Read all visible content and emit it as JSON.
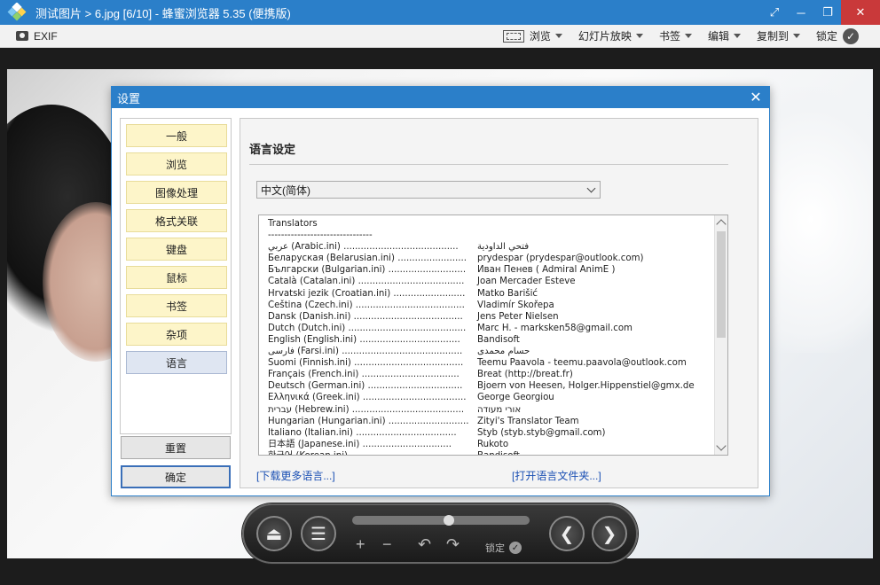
{
  "window": {
    "title": "测试图片 > 6.jpg [6/10] - 蜂蜜浏览器 5.35 (便携版)",
    "controls": [
      "⤢",
      "─",
      "❐",
      "✕"
    ]
  },
  "toolbar": {
    "exif": "EXIF",
    "menus": [
      "浏览",
      "幻灯片放映",
      "书签",
      "编辑",
      "复制到"
    ],
    "lock": "锁定",
    "lock_check": "✓"
  },
  "player": {
    "eject": "⏏",
    "menu": "☰",
    "plus": "+",
    "minus": "−",
    "rot_left": "↶",
    "rot_right": "↷",
    "lock": "锁定",
    "lock_check": "✓",
    "prev": "❮",
    "next": "❯",
    "progress": 0.55
  },
  "dialog": {
    "title": "设置",
    "close": "✕",
    "nav": [
      "一般",
      "浏览",
      "图像处理",
      "格式关联",
      "键盘",
      "鼠标",
      "书签",
      "杂项",
      "语言"
    ],
    "active_nav": "语言",
    "reset_button": "重置",
    "ok_button": "确定",
    "section_title": "语言设定",
    "language_select": "中文(简体)",
    "list_header": "Translators",
    "list_separator": "--------------------------------",
    "translators": [
      {
        "lang": "عربي (Arabic.ini) ........................................",
        "by": "فتحي الداودية"
      },
      {
        "lang": "Беларуская (Belarusian.ini) ........................",
        "by": "prydespar (prydespar@outlook.com)"
      },
      {
        "lang": "Български (Bulgarian.ini) ...........................",
        "by": "Иван Пенев ( Admiral AnimE )"
      },
      {
        "lang": "Català (Catalan.ini) .....................................",
        "by": "Joan Mercader Esteve"
      },
      {
        "lang": "Hrvatski jezik (Croatian.ini) .........................",
        "by": "Matko Barišić"
      },
      {
        "lang": "Čeština (Czech.ini) ......................................",
        "by": "Vladimír Skořepa"
      },
      {
        "lang": "Dansk (Danish.ini) ......................................",
        "by": "Jens Peter Nielsen"
      },
      {
        "lang": "Dutch (Dutch.ini) .........................................",
        "by": "Marc H. - marksken58@gmail.com"
      },
      {
        "lang": "English (English.ini) ...................................",
        "by": "Bandisoft"
      },
      {
        "lang": "فارسی (Farsi.ini) ..........................................",
        "by": "حسام محمدی"
      },
      {
        "lang": "Suomi (Finnish.ini) ......................................",
        "by": "Teemu Paavola - teemu.paavola@outlook.com"
      },
      {
        "lang": "Français (French.ini) ..................................",
        "by": "Breat (http://breat.fr)"
      },
      {
        "lang": "Deutsch (German.ini) .................................",
        "by": "Bjoern von Heesen, Holger.Hippenstiel@gmx.de"
      },
      {
        "lang": "Ελληνικά (Greek.ini) ....................................",
        "by": "George Georgiou"
      },
      {
        "lang": "עברית (Hebrew.ini) .......................................",
        "by": "אורי מעודה"
      },
      {
        "lang": "Hungarian (Hungarian.ini) ............................",
        "by": "Zityi's Translator Team"
      },
      {
        "lang": "Italiano (Italian.ini) ...................................",
        "by": "Styb (styb.styb@gmail.com)"
      },
      {
        "lang": "日本語 (Japanese.ini) ...............................",
        "by": "Rukoto"
      },
      {
        "lang": "한국어 (Korean.ini) .....................................",
        "by": "Bandisoft"
      }
    ],
    "download_link": "[下载更多语言...]",
    "open_folder_link": "[打开语言文件夹...]"
  },
  "colors": {
    "accent": "#2b7fc9",
    "nav_item": "#fdf5c9",
    "nav_active": "#dfe6f2",
    "link": "#1a4fb3"
  }
}
